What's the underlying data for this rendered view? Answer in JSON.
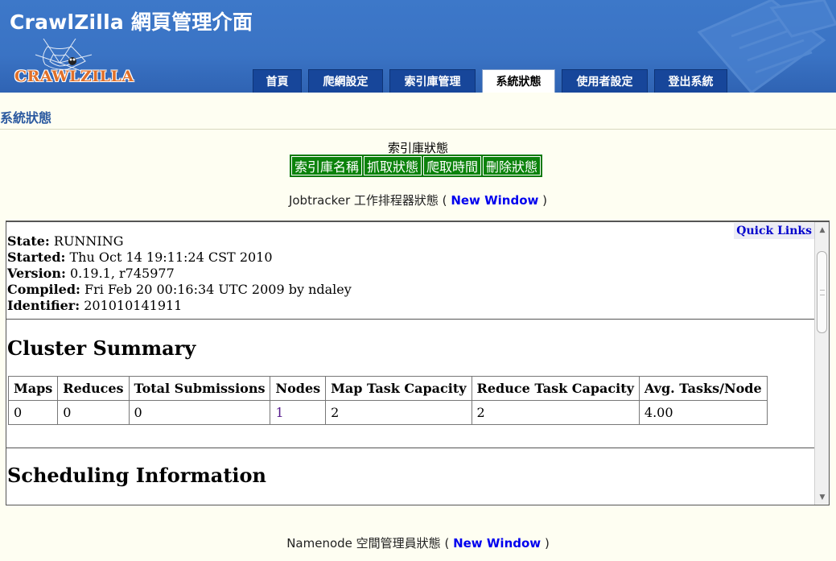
{
  "header": {
    "app_title": "CrawlZilla 網頁管理介面",
    "logo_text": "CRAWLZILLA",
    "colors": {
      "header_blue": "#3a73c4",
      "tab_blue": "#17469a",
      "logo_orange": "#e0702a"
    }
  },
  "nav": {
    "tabs": [
      {
        "label": "首頁",
        "icon": "",
        "active": false
      },
      {
        "label": "爬網設定",
        "active": false
      },
      {
        "label": "索引庫管理",
        "active": false
      },
      {
        "label": "系統狀態",
        "active": true
      },
      {
        "label": "使用者設定",
        "active": false
      },
      {
        "label": "登出系統",
        "active": false
      }
    ]
  },
  "page": {
    "section_title": "系統狀態",
    "index_status_heading": "索引庫狀態",
    "index_buttons": [
      "索引庫名稱",
      "抓取狀態",
      "爬取時間",
      "刪除狀態"
    ],
    "button_color": "#0b820b",
    "jobtracker_label": "Jobtracker 工作排程器狀態",
    "namenode_label": "Namenode 空間管理員狀態",
    "new_window_link": "New Window",
    "paren_open": "(",
    "paren_close": ")"
  },
  "frame": {
    "quick_links": "Quick Links",
    "info": [
      {
        "label": "State:",
        "value": "RUNNING"
      },
      {
        "label": "Started:",
        "value": "Thu Oct 14 19:11:24 CST 2010"
      },
      {
        "label": "Version:",
        "value": "0.19.1, r745977"
      },
      {
        "label": "Compiled:",
        "value": "Fri Feb 20 00:16:34 UTC 2009 by ndaley"
      },
      {
        "label": "Identifier:",
        "value": "201010141911"
      }
    ],
    "cluster_summary_title": "Cluster Summary",
    "summary_headers": [
      "Maps",
      "Reduces",
      "Total Submissions",
      "Nodes",
      "Map Task Capacity",
      "Reduce Task Capacity",
      "Avg. Tasks/Node"
    ],
    "summary_values": [
      "0",
      "0",
      "0",
      "1",
      "2",
      "2",
      "4.00"
    ],
    "scheduling_title": "Scheduling Information",
    "scroll_up_icon": "scroll-up-arrow-icon",
    "scroll_down_icon": "scroll-down-arrow-icon"
  }
}
